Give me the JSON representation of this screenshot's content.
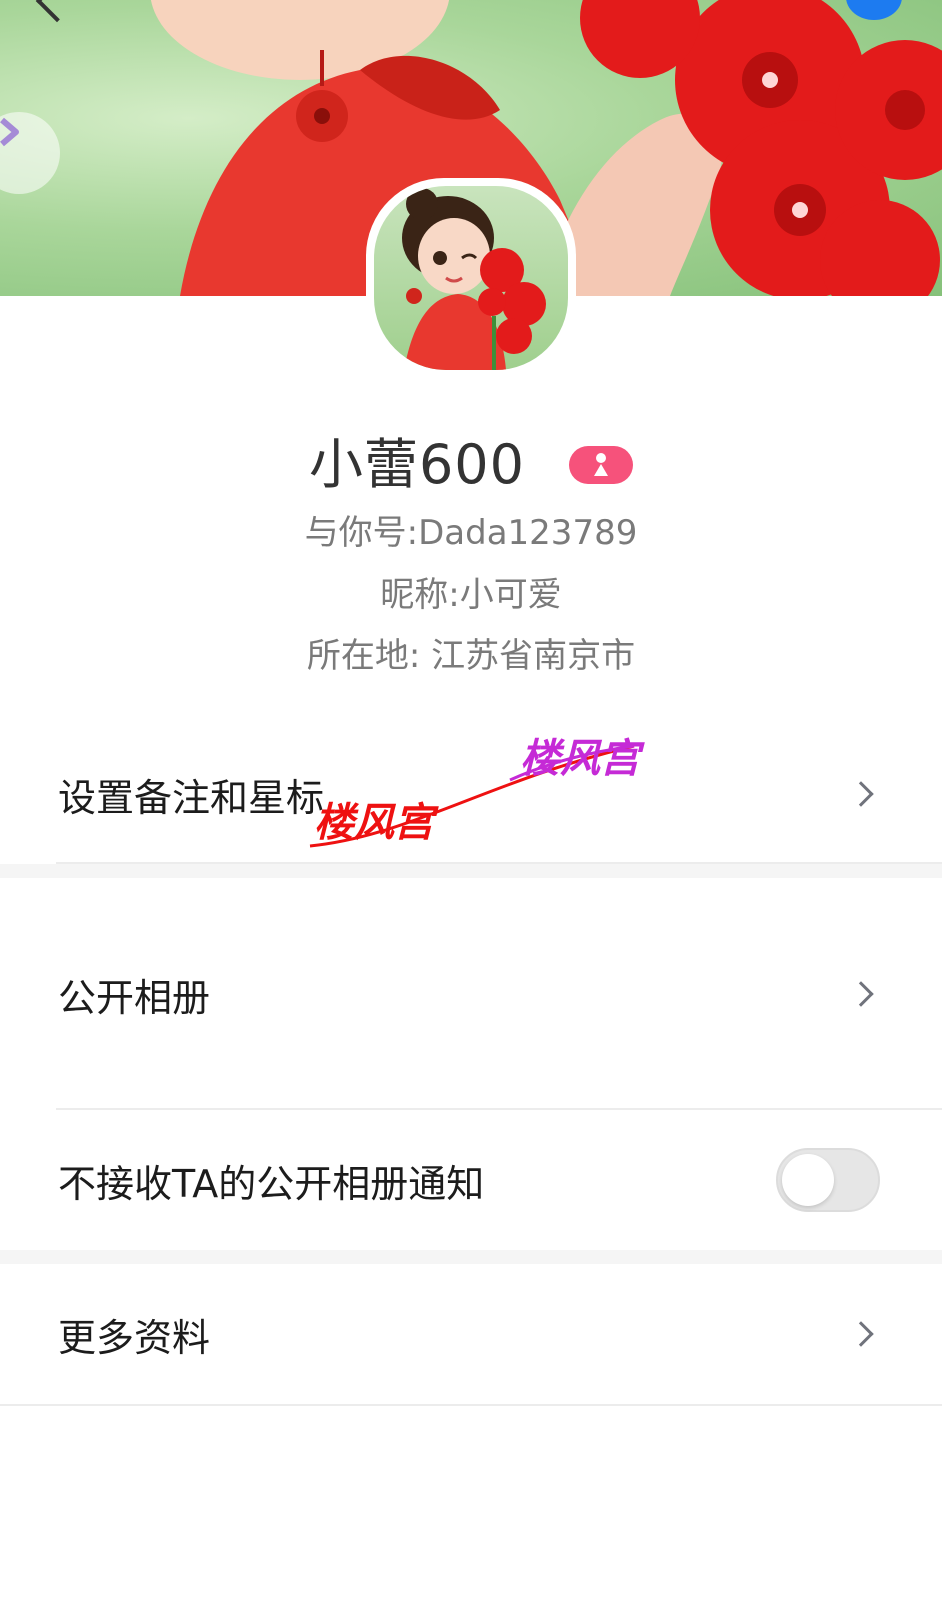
{
  "cover": {},
  "profile": {
    "name": "小蕾600",
    "id_line": "与你号:Dada123789",
    "nickname_line": "昵称:小可爱",
    "location_line": "所在地: 江苏省南京市",
    "gender": "female",
    "gender_color": "#f6527b"
  },
  "menu": {
    "remark": "设置备注和星标",
    "album": "公开相册",
    "mute_album": "不接收TA的公开相册通知",
    "mute_album_on": false,
    "more_info": "更多资料"
  },
  "watermark": {
    "text_a": "楼风宫",
    "text_b": "楼风宫"
  },
  "colors": {
    "accent_blue": "#1d7bf0",
    "toggle_off": "#e6e6e6"
  }
}
